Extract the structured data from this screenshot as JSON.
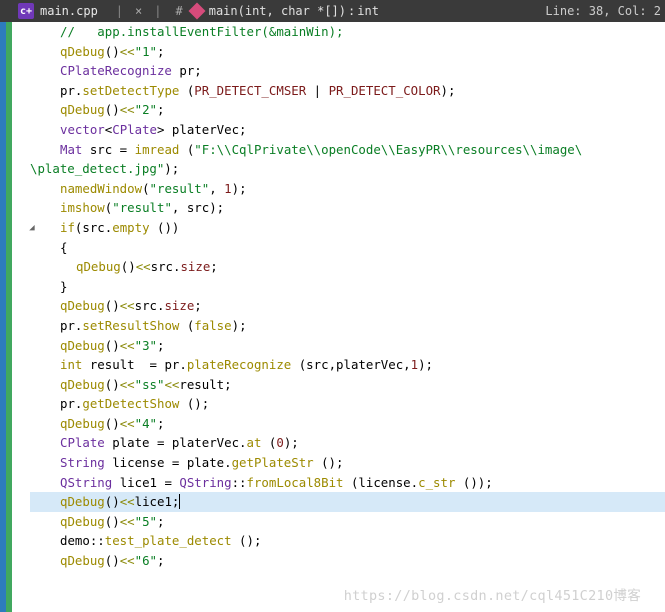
{
  "titlebar": {
    "filename": "main.cpp",
    "separator": "|",
    "close_glyph": "×",
    "hash": "#",
    "function_sig": "main(int, char *[])",
    "return_sep": ": ",
    "return_type": "int",
    "position": "Line: 38, Col: 2"
  },
  "code": [
    {
      "i": 1,
      "h": [
        {
          "c": "comment",
          "t": "// "
        },
        {
          "c": "comment",
          "t": "  app.installEventFilter(&mainWin);"
        }
      ]
    },
    {
      "i": 1,
      "h": [
        {
          "c": "fn",
          "t": "qDebug"
        },
        {
          "c": "plain",
          "t": "()"
        },
        {
          "c": "oliveop",
          "t": "<<"
        },
        {
          "c": "str",
          "t": "\"1\""
        },
        {
          "c": "plain",
          "t": ";"
        }
      ]
    },
    {
      "i": 1,
      "h": [
        {
          "c": "type",
          "t": "CPlateRecognize "
        },
        {
          "c": "plain",
          "t": "pr;"
        }
      ]
    },
    {
      "i": 1,
      "h": [
        {
          "c": "plain",
          "t": "pr."
        },
        {
          "c": "fn",
          "t": "setDetectType"
        },
        {
          "c": "plain",
          "t": " ("
        },
        {
          "c": "var",
          "t": "PR_DETECT_CMSER"
        },
        {
          "c": "plain",
          "t": " | "
        },
        {
          "c": "var",
          "t": "PR_DETECT_COLOR"
        },
        {
          "c": "plain",
          "t": ");"
        }
      ]
    },
    {
      "i": 1,
      "h": [
        {
          "c": "fn",
          "t": "qDebug"
        },
        {
          "c": "plain",
          "t": "()"
        },
        {
          "c": "oliveop",
          "t": "<<"
        },
        {
          "c": "str",
          "t": "\"2\""
        },
        {
          "c": "plain",
          "t": ";"
        }
      ]
    },
    {
      "i": 1,
      "h": [
        {
          "c": "type",
          "t": "vector"
        },
        {
          "c": "plain",
          "t": "<"
        },
        {
          "c": "type",
          "t": "CPlate"
        },
        {
          "c": "plain",
          "t": "> platerVec;"
        }
      ]
    },
    {
      "i": 1,
      "h": [
        {
          "c": "type",
          "t": "Mat "
        },
        {
          "c": "plain",
          "t": "src = "
        },
        {
          "c": "fn",
          "t": "imread"
        },
        {
          "c": "plain",
          "t": " ("
        },
        {
          "c": "str",
          "t": "\"F:\\\\CqlPrivate\\\\openCode\\\\EasyPR\\\\resources\\\\image\\"
        }
      ]
    },
    {
      "i": 0,
      "h": [
        {
          "c": "str",
          "t": "\\plate_detect.jpg\""
        },
        {
          "c": "plain",
          "t": ");"
        }
      ]
    },
    {
      "i": 1,
      "h": [
        {
          "c": "fn",
          "t": "namedWindow"
        },
        {
          "c": "plain",
          "t": "("
        },
        {
          "c": "str",
          "t": "\"result\""
        },
        {
          "c": "plain",
          "t": ", "
        },
        {
          "c": "num",
          "t": "1"
        },
        {
          "c": "plain",
          "t": ");"
        }
      ]
    },
    {
      "i": 1,
      "h": [
        {
          "c": "fn",
          "t": "imshow"
        },
        {
          "c": "plain",
          "t": "("
        },
        {
          "c": "str",
          "t": "\"result\""
        },
        {
          "c": "plain",
          "t": ", src);"
        }
      ]
    },
    {
      "i": 1,
      "fold": true,
      "h": [
        {
          "c": "kw",
          "t": "if"
        },
        {
          "c": "plain",
          "t": "(src."
        },
        {
          "c": "fn",
          "t": "empty"
        },
        {
          "c": "plain",
          "t": " ())"
        }
      ]
    },
    {
      "i": 1,
      "h": [
        {
          "c": "plain",
          "t": "{"
        }
      ]
    },
    {
      "i": 2,
      "h": [
        {
          "c": "fn",
          "t": "qDebug"
        },
        {
          "c": "plain",
          "t": "()"
        },
        {
          "c": "oliveop",
          "t": "<<"
        },
        {
          "c": "plain",
          "t": "src."
        },
        {
          "c": "var",
          "t": "size"
        },
        {
          "c": "plain",
          "t": ";"
        }
      ]
    },
    {
      "i": 1,
      "h": [
        {
          "c": "plain",
          "t": "}"
        }
      ]
    },
    {
      "i": 1,
      "h": [
        {
          "c": "fn",
          "t": "qDebug"
        },
        {
          "c": "plain",
          "t": "()"
        },
        {
          "c": "oliveop",
          "t": "<<"
        },
        {
          "c": "plain",
          "t": "src."
        },
        {
          "c": "var",
          "t": "size"
        },
        {
          "c": "plain",
          "t": ";"
        }
      ]
    },
    {
      "i": 1,
      "h": [
        {
          "c": "plain",
          "t": "pr."
        },
        {
          "c": "fn",
          "t": "setResultShow"
        },
        {
          "c": "plain",
          "t": " ("
        },
        {
          "c": "kw",
          "t": "false"
        },
        {
          "c": "plain",
          "t": ");"
        }
      ]
    },
    {
      "i": 1,
      "h": [
        {
          "c": "fn",
          "t": "qDebug"
        },
        {
          "c": "plain",
          "t": "()"
        },
        {
          "c": "oliveop",
          "t": "<<"
        },
        {
          "c": "str",
          "t": "\"3\""
        },
        {
          "c": "plain",
          "t": ";"
        }
      ]
    },
    {
      "i": 1,
      "h": [
        {
          "c": "kw",
          "t": "int"
        },
        {
          "c": "plain",
          "t": " result  = pr."
        },
        {
          "c": "fn",
          "t": "plateRecognize"
        },
        {
          "c": "plain",
          "t": " (src,platerVec,"
        },
        {
          "c": "num",
          "t": "1"
        },
        {
          "c": "plain",
          "t": ");"
        }
      ]
    },
    {
      "i": 1,
      "h": [
        {
          "c": "fn",
          "t": "qDebug"
        },
        {
          "c": "plain",
          "t": "()"
        },
        {
          "c": "oliveop",
          "t": "<<"
        },
        {
          "c": "str",
          "t": "\"ss\""
        },
        {
          "c": "oliveop",
          "t": "<<"
        },
        {
          "c": "plain",
          "t": "result;"
        }
      ]
    },
    {
      "i": 1,
      "h": [
        {
          "c": "plain",
          "t": "pr."
        },
        {
          "c": "fn",
          "t": "getDetectShow"
        },
        {
          "c": "plain",
          "t": " ();"
        }
      ]
    },
    {
      "i": 1,
      "h": [
        {
          "c": "fn",
          "t": "qDebug"
        },
        {
          "c": "plain",
          "t": "()"
        },
        {
          "c": "oliveop",
          "t": "<<"
        },
        {
          "c": "str",
          "t": "\"4\""
        },
        {
          "c": "plain",
          "t": ";"
        }
      ]
    },
    {
      "i": 1,
      "h": [
        {
          "c": "type",
          "t": "CPlate "
        },
        {
          "c": "plain",
          "t": "plate = platerVec."
        },
        {
          "c": "fn",
          "t": "at"
        },
        {
          "c": "plain",
          "t": " ("
        },
        {
          "c": "num",
          "t": "0"
        },
        {
          "c": "plain",
          "t": ");"
        }
      ]
    },
    {
      "i": 1,
      "h": [
        {
          "c": "type",
          "t": "String "
        },
        {
          "c": "plain",
          "t": "license = plate."
        },
        {
          "c": "fn",
          "t": "getPlateStr"
        },
        {
          "c": "plain",
          "t": " ();"
        }
      ]
    },
    {
      "i": 1,
      "h": [
        {
          "c": "type",
          "t": "QString "
        },
        {
          "c": "plain",
          "t": "lice1 = "
        },
        {
          "c": "type",
          "t": "QString"
        },
        {
          "c": "plain",
          "t": "::"
        },
        {
          "c": "fn",
          "t": "fromLocal8Bit"
        },
        {
          "c": "plain",
          "t": " (license."
        },
        {
          "c": "fn",
          "t": "c_str"
        },
        {
          "c": "plain",
          "t": " ());"
        }
      ]
    },
    {
      "i": 1,
      "hl": true,
      "cursor": true,
      "h": [
        {
          "c": "fn",
          "t": "qDebug"
        },
        {
          "c": "plain",
          "t": "()"
        },
        {
          "c": "oliveop",
          "t": "<<"
        },
        {
          "c": "plain",
          "t": "lice1;"
        }
      ]
    },
    {
      "i": 1,
      "h": [
        {
          "c": "fn",
          "t": "qDebug"
        },
        {
          "c": "plain",
          "t": "()"
        },
        {
          "c": "oliveop",
          "t": "<<"
        },
        {
          "c": "str",
          "t": "\"5\""
        },
        {
          "c": "plain",
          "t": ";"
        }
      ]
    },
    {
      "i": 1,
      "h": [
        {
          "c": "plain",
          "t": "demo::"
        },
        {
          "c": "fn",
          "t": "test_plate_detect"
        },
        {
          "c": "plain",
          "t": " ();"
        }
      ]
    },
    {
      "i": 1,
      "h": [
        {
          "c": "fn",
          "t": "qDebug"
        },
        {
          "c": "plain",
          "t": "()"
        },
        {
          "c": "oliveop",
          "t": "<<"
        },
        {
          "c": "str",
          "t": "\"6\""
        },
        {
          "c": "plain",
          "t": ";"
        }
      ]
    }
  ],
  "watermark": "https://blog.csdn.net/cql451C210博客"
}
